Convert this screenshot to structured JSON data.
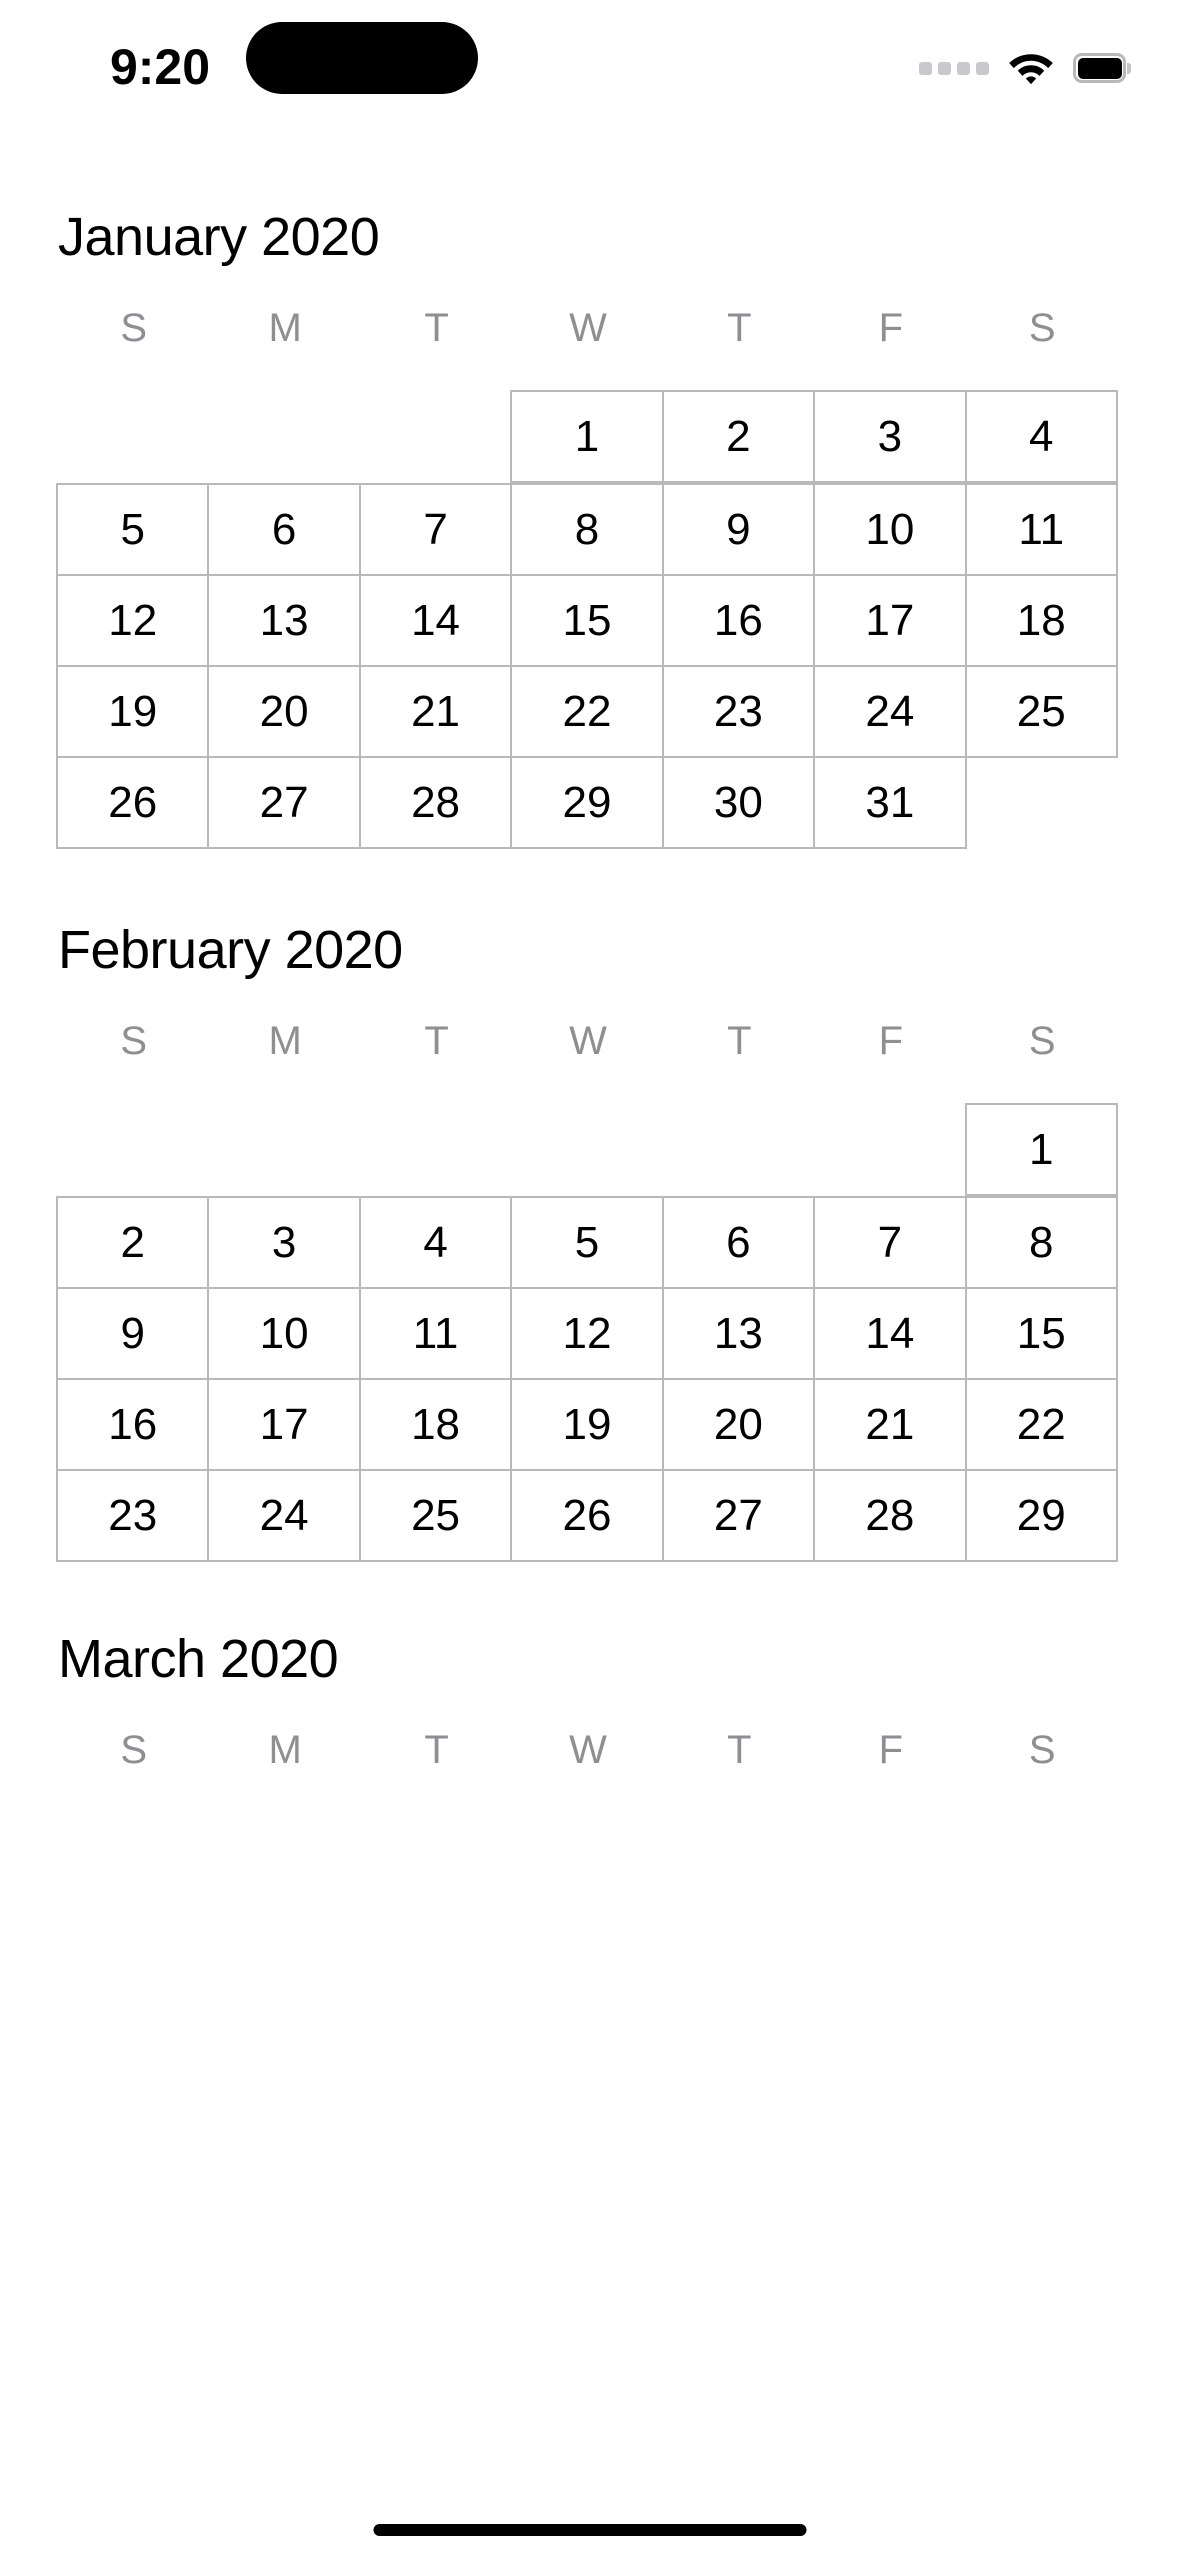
{
  "status_bar": {
    "time": "9:20",
    "icons": {
      "signal": "signal-dots-icon",
      "wifi": "wifi-icon",
      "battery": "battery-icon"
    }
  },
  "weekday_labels": [
    "S",
    "M",
    "T",
    "W",
    "T",
    "F",
    "S"
  ],
  "months": [
    {
      "title": "January 2020",
      "lead_blanks": 3,
      "days": [
        1,
        2,
        3,
        4,
        5,
        6,
        7,
        8,
        9,
        10,
        11,
        12,
        13,
        14,
        15,
        16,
        17,
        18,
        19,
        20,
        21,
        22,
        23,
        24,
        25,
        26,
        27,
        28,
        29,
        30,
        31
      ],
      "trail_blanks": 1
    },
    {
      "title": "February 2020",
      "lead_blanks": 6,
      "days": [
        1,
        2,
        3,
        4,
        5,
        6,
        7,
        8,
        9,
        10,
        11,
        12,
        13,
        14,
        15,
        16,
        17,
        18,
        19,
        20,
        21,
        22,
        23,
        24,
        25,
        26,
        27,
        28,
        29
      ],
      "trail_blanks": 0
    },
    {
      "title": "March 2020",
      "lead_blanks": 0,
      "days": [],
      "trail_blanks": 0
    }
  ]
}
